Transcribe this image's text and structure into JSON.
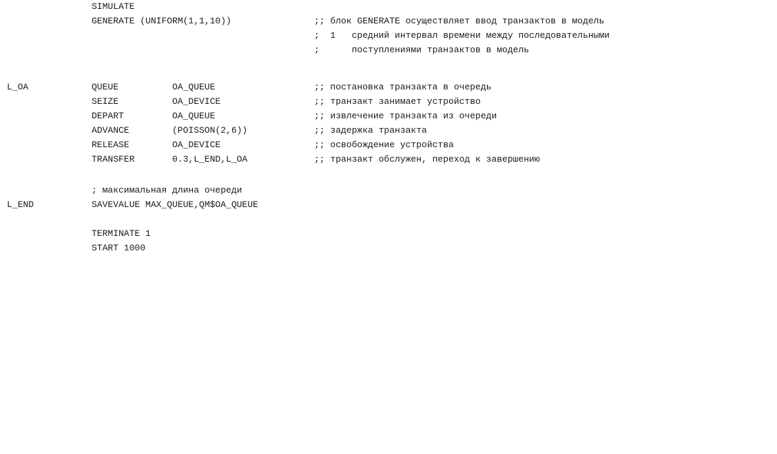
{
  "program": {
    "simulate": "SIMULATE",
    "generate_stmt": "GENERATE (UNIFORM(1,1,10))",
    "generate_comment_1": ";; блок GENERATE осуществляет ввод транзактов в модель",
    "generate_comment_2": ";  1   средний интервал времени между последовательными",
    "generate_comment_3": ";      поступлениями транзактов в модель",
    "label_l_oa": "L_OA",
    "queue_op": "QUEUE",
    "queue_arg": "OA_QUEUE",
    "queue_comment": ";; постановка транзакта в очередь",
    "seize_op": "SEIZE",
    "seize_arg": "OA_DEVICE",
    "seize_comment": ";; транзакт занимает устройство",
    "depart_op": "DEPART",
    "depart_arg": "OA_QUEUE",
    "depart_comment": ";; извлечение транзакта из очереди",
    "advance_op": "ADVANCE",
    "advance_arg": "(POISSON(2,6))",
    "advance_comment": ";; задержка транзакта",
    "release_op": "RELEASE",
    "release_arg": "OA_DEVICE",
    "release_comment": ";; освобождение устройства",
    "transfer_op": "TRANSFER",
    "transfer_arg": "0.3,L_END,L_OA",
    "transfer_comment": ";; транзакт обслужен, переход к завершению",
    "maxqueue_comment": "; максимальная длина очереди",
    "label_l_end": "L_END",
    "savevalue_stmt": "SAVEVALUE MAX_QUEUE,QM$OA_QUEUE",
    "terminate_stmt": "TERMINATE 1",
    "start_stmt": "START 1000"
  }
}
